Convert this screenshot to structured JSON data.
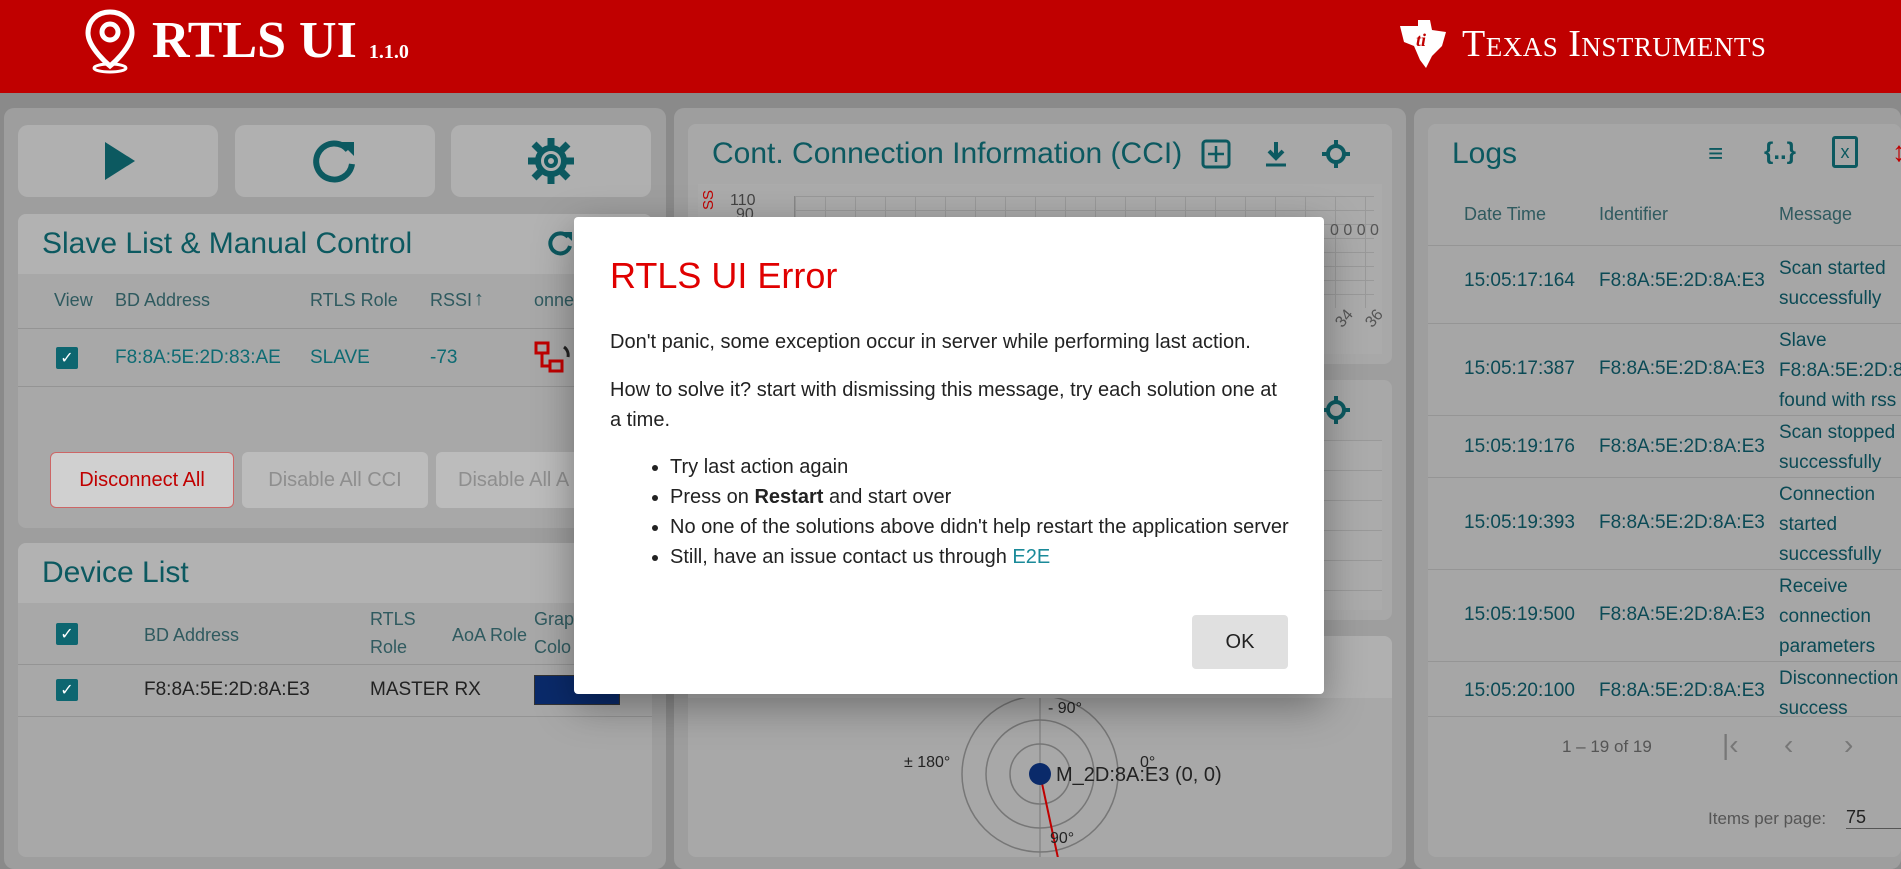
{
  "header": {
    "title": "RTLS UI",
    "version": "1.1.0",
    "brand": "Texas Instruments"
  },
  "controls": {
    "play": "play-icon",
    "restart": "refresh-icon",
    "settings": "gear-icon"
  },
  "slave_list": {
    "title": "Slave List & Manual Control",
    "columns": [
      "View",
      "BD Address",
      "RTLS Role",
      "RSSI",
      "onne..."
    ],
    "row": {
      "address": "F8:8A:5E:2D:83:AE",
      "role": "SLAVE",
      "rssi": "-73"
    },
    "buttons": {
      "disconnect": "Disconnect All",
      "disable_cci": "Disable All CCI",
      "disable_aoa": "Disable All A"
    }
  },
  "device_list": {
    "title": "Device List",
    "columns": {
      "address": "BD Address",
      "rtls1": "RTLS",
      "rtls2": "Role",
      "aoa": "AoA Role",
      "graph1": "Grap",
      "graph2": "Colo"
    },
    "row": {
      "address": "F8:8A:5E:2D:8A:E3",
      "role": "MASTER RX"
    }
  },
  "cci": {
    "title": "Cont. Connection Information (CCI)",
    "y_ticks": [
      "110",
      "90"
    ],
    "x_ticks": [
      "34",
      "36"
    ],
    "right_values": "0 0 0 0",
    "rssi_label": "SS"
  },
  "polar": {
    "top": "- 90°",
    "left": "± 180°",
    "right": "0°",
    "bottom": "90°",
    "point_label": "M_2D:8A:E3 (0, 0)"
  },
  "logs": {
    "title": "Logs",
    "columns": {
      "dt": "Date Time",
      "id": "Identifier",
      "msg": "Message"
    },
    "rows": [
      {
        "dt": "15:05:17:164",
        "id": "F8:8A:5E:2D:8A:E3",
        "msg": [
          "Scan started",
          "successfully"
        ]
      },
      {
        "dt": "15:05:17:387",
        "id": "F8:8A:5E:2D:8A:E3",
        "msg": [
          "Slave",
          "F8:8A:5E:2D:8",
          "found with rss"
        ]
      },
      {
        "dt": "15:05:19:176",
        "id": "F8:8A:5E:2D:8A:E3",
        "msg": [
          "Scan stopped",
          "successfully"
        ]
      },
      {
        "dt": "15:05:19:393",
        "id": "F8:8A:5E:2D:8A:E3",
        "msg": [
          "Connection",
          "started",
          "successfully"
        ]
      },
      {
        "dt": "15:05:19:500",
        "id": "F8:8A:5E:2D:8A:E3",
        "msg": [
          "Receive",
          "connection",
          "parameters"
        ]
      },
      {
        "dt": "15:05:20:100",
        "id": "F8:8A:5E:2D:8A:E3",
        "msg": [
          "Disconnection",
          "success"
        ]
      }
    ],
    "range": "1 – 19 of 19",
    "items_per_page_label": "Items per page:",
    "items_per_page": "75"
  },
  "dialog": {
    "title": "RTLS UI Error",
    "message": "Don't panic, some exception occur in server while performing last action.",
    "how_to": "How to solve it? start with dismissing this message, try each solution one at a time.",
    "items": {
      "i1": "Try last action again",
      "i2_pre": "Press on ",
      "i2_bold": "Restart",
      "i2_post": " and start over",
      "i3": "No one of the solutions above didn't help restart the application server",
      "i4_pre": "Still, have an issue contact us through ",
      "i4_link": "E2E"
    },
    "ok": "OK"
  },
  "colors": {
    "header": "#c00000",
    "teal": "#0e6b73",
    "error_red": "#e00000",
    "device_graph": "#0a2a6a"
  }
}
